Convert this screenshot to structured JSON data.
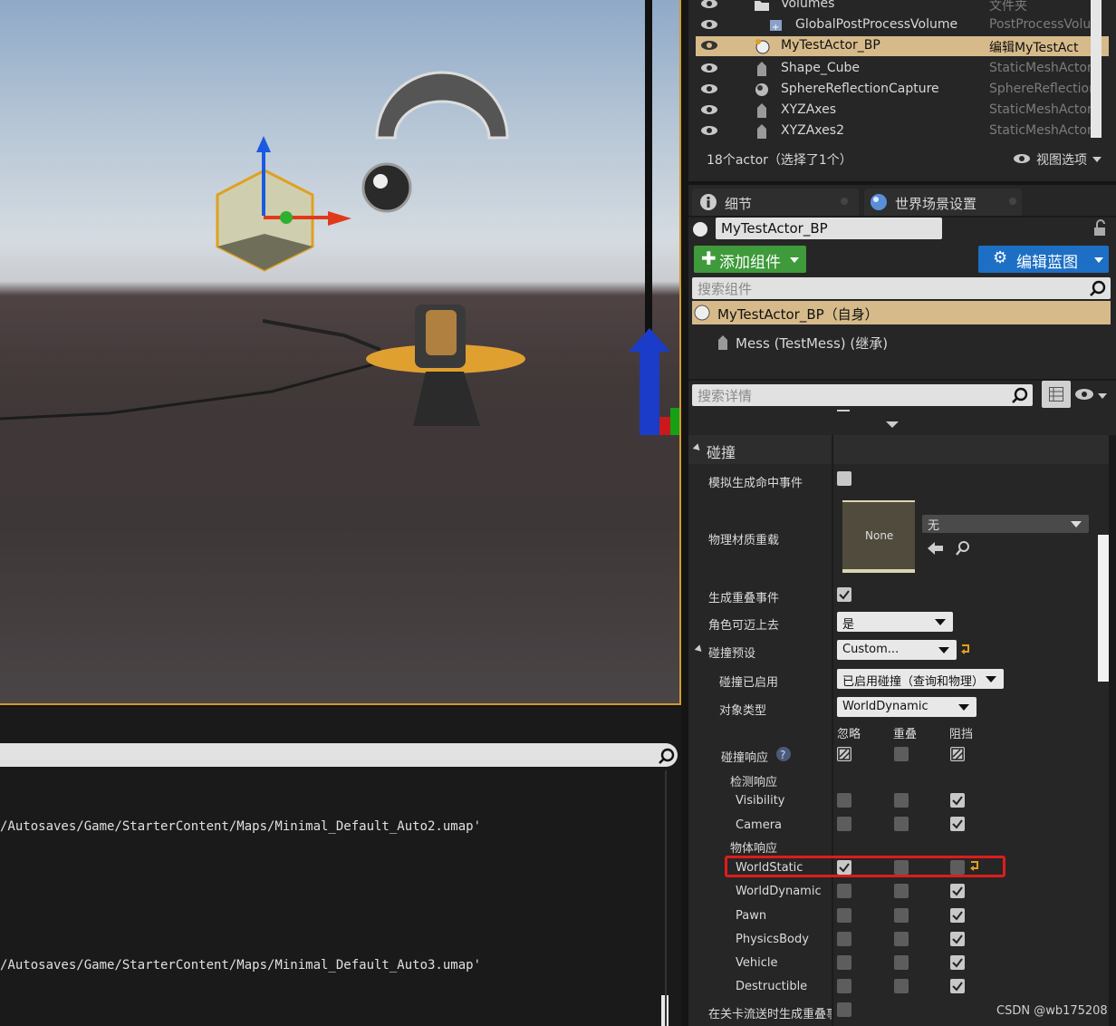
{
  "outliner": {
    "rows": [
      {
        "name": "Volumes",
        "type": "文件夹",
        "icon": "folder-icon",
        "selected": false
      },
      {
        "name": "GlobalPostProcessVolume",
        "type": "PostProcessVolu",
        "icon": "post-process-icon",
        "selected": false
      },
      {
        "name": "MyTestActor_BP",
        "type": "编辑MyTestAct",
        "icon": "actor-icon",
        "selected": true
      },
      {
        "name": "Shape_Cube",
        "type": "StaticMeshActor",
        "icon": "static-mesh-icon",
        "selected": false
      },
      {
        "name": "SphereReflectionCapture",
        "type": "SphereReflection",
        "icon": "reflection-capture-icon",
        "selected": false
      },
      {
        "name": "XYZAxes",
        "type": "StaticMeshActor",
        "icon": "static-mesh-icon",
        "selected": false
      },
      {
        "name": "XYZAxes2",
        "type": "StaticMeshActor",
        "icon": "static-mesh-icon",
        "selected": false
      }
    ],
    "status": "18个actor（选择了1个）",
    "view_options": "视图选项"
  },
  "details": {
    "tabs": [
      {
        "label": "细节"
      },
      {
        "label": "世界场景设置"
      }
    ],
    "actor_name": "MyTestActor_BP",
    "add_component": "添加组件",
    "edit_blueprint": "编辑蓝图",
    "search_components_placeholder": "搜索组件",
    "components": [
      {
        "label": "MyTestActor_BP（自身）"
      },
      {
        "label": "Mess (TestMess) (继承)"
      }
    ],
    "search_details_placeholder": "搜索详情",
    "section": "碰撞",
    "props": {
      "sim_hit": "模拟生成命中事件",
      "phys_mat": "物理材质重载",
      "phys_mat_thumb": "None",
      "phys_mat_value": "无",
      "gen_overlap": "生成重叠事件",
      "can_step": "角色可迈上去",
      "can_step_value": "是",
      "preset": "碰撞预设",
      "preset_value": "Custom...",
      "enabled": "碰撞已启用",
      "enabled_value": "已启用碰撞（查询和物理）",
      "obj_type": "对象类型",
      "obj_type_value": "WorldDynamic",
      "col_ignore": "忽略",
      "col_overlap": "重叠",
      "col_block": "阻挡",
      "responses": "碰撞响应",
      "trace": "检测响应",
      "object": "物体响应",
      "streaming": "在关卡流送时生成重叠事"
    },
    "response_rows": [
      {
        "label": "Visibility",
        "ignore": false,
        "overlap": false,
        "block": true
      },
      {
        "label": "Camera",
        "ignore": false,
        "overlap": false,
        "block": true
      },
      {
        "label": "WorldStatic",
        "ignore": true,
        "overlap": false,
        "block": false
      },
      {
        "label": "WorldDynamic",
        "ignore": false,
        "overlap": false,
        "block": true
      },
      {
        "label": "Pawn",
        "ignore": false,
        "overlap": false,
        "block": true
      },
      {
        "label": "PhysicsBody",
        "ignore": false,
        "overlap": false,
        "block": true
      },
      {
        "label": "Vehicle",
        "ignore": false,
        "overlap": false,
        "block": true
      },
      {
        "label": "Destructible",
        "ignore": false,
        "overlap": false,
        "block": true
      }
    ]
  },
  "console": {
    "lines": [
      "/Autosaves/Game/StarterContent/Maps/Minimal_Default_Auto2.umap'",
      "/Autosaves/Game/StarterContent/Maps/Minimal_Default_Auto3.umap'"
    ]
  },
  "watermark": "CSDN @wb175208",
  "colors": {
    "selection": "#d6ba8a",
    "highlight": "#e01c1c",
    "add_button": "#3e9a3a",
    "blueprint_button": "#1c6fc4",
    "viewport_border": "#d19a2a"
  }
}
